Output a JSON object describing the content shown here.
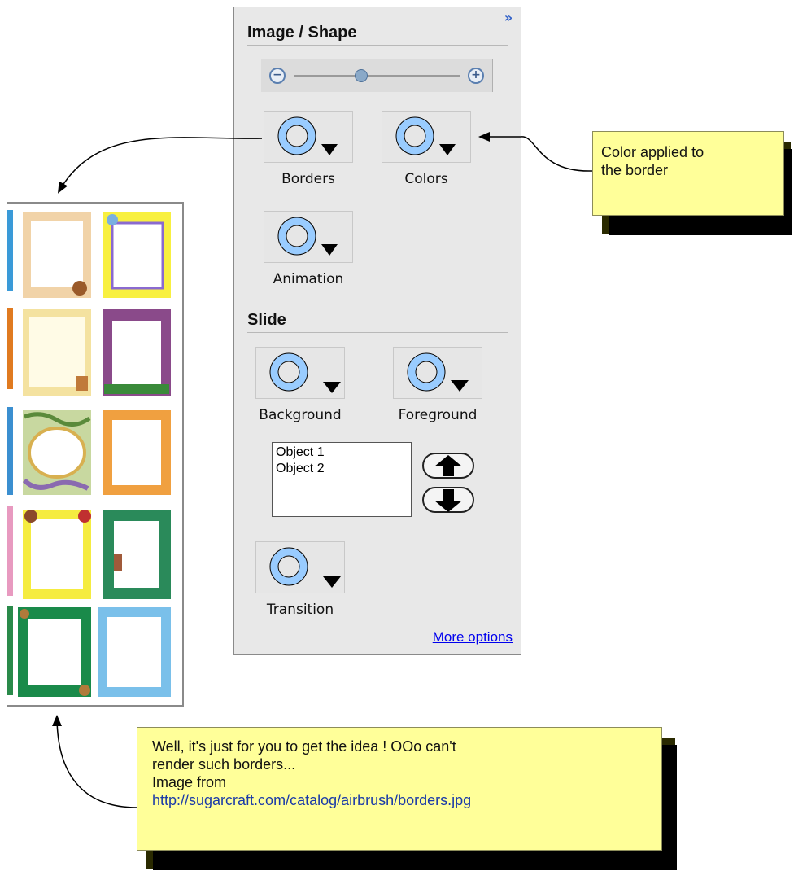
{
  "panel": {
    "collapse_icon": "chevron-double-right-icon",
    "image_shape": {
      "title": "Image / Shape",
      "zoom": {
        "min_icon": "minus-circle-icon",
        "max_icon": "plus-circle-icon",
        "value": 0.4
      },
      "tools": [
        {
          "label": "Borders"
        },
        {
          "label": "Colors"
        },
        {
          "label": "Animation"
        }
      ]
    },
    "slide": {
      "title": "Slide",
      "tools": [
        {
          "label": "Background"
        },
        {
          "label": "Foreground"
        },
        {
          "label": "Transition"
        }
      ],
      "objects": [
        "Object 1",
        "Object 2"
      ],
      "move_up_icon": "arrow-up-icon",
      "move_down_icon": "arrow-down-icon"
    },
    "more_options": "More options"
  },
  "notes": {
    "color": {
      "lines": [
        "Color applied to",
        "the border"
      ]
    },
    "idea": {
      "lines": [
        "Well, it's just for you to get the idea ! OOo can't",
        "render such borders...",
        "Image from"
      ],
      "url": "http://sugarcraft.com/catalog/airbrush/borders.jpg"
    }
  },
  "colors": {
    "panel_bg": "#e8e8e8",
    "note_bg": "#ffff99",
    "ring": "#99ccff",
    "link": "#0000ee"
  }
}
